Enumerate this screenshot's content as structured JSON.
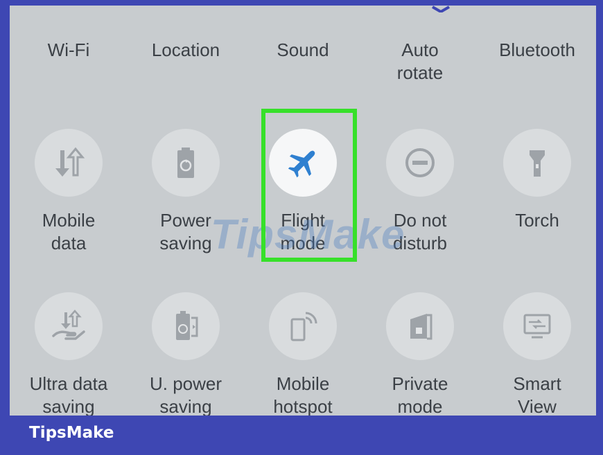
{
  "top_row": [
    {
      "label": "Wi-Fi"
    },
    {
      "label": "Location"
    },
    {
      "label": "Sound"
    },
    {
      "label": "Auto\nrotate"
    },
    {
      "label": "Bluetooth"
    }
  ],
  "middle_row": [
    {
      "label": "Mobile\ndata",
      "icon": "mobile-data-icon"
    },
    {
      "label": "Power\nsaving",
      "icon": "battery-recycle-icon"
    },
    {
      "label": "Flight\nmode",
      "icon": "airplane-icon",
      "active": true
    },
    {
      "label": "Do not\ndisturb",
      "icon": "do-not-disturb-icon"
    },
    {
      "label": "Torch",
      "icon": "torch-icon"
    }
  ],
  "bottom_row": [
    {
      "label": "Ultra data\nsaving",
      "icon": "ultra-data-saving-icon"
    },
    {
      "label": "U. power\nsaving",
      "icon": "ultra-power-saving-icon"
    },
    {
      "label": "Mobile\nhotspot",
      "icon": "hotspot-icon"
    },
    {
      "label": "Private\nmode",
      "icon": "private-mode-icon"
    },
    {
      "label": "Smart\nView",
      "icon": "smart-view-icon"
    }
  ],
  "watermark": "TipsMake",
  "brand": "TipsMake",
  "colors": {
    "frame": "#3e47b3",
    "panel": "#c8cccf",
    "highlight": "#37e02a",
    "airplane": "#2f80d0"
  }
}
